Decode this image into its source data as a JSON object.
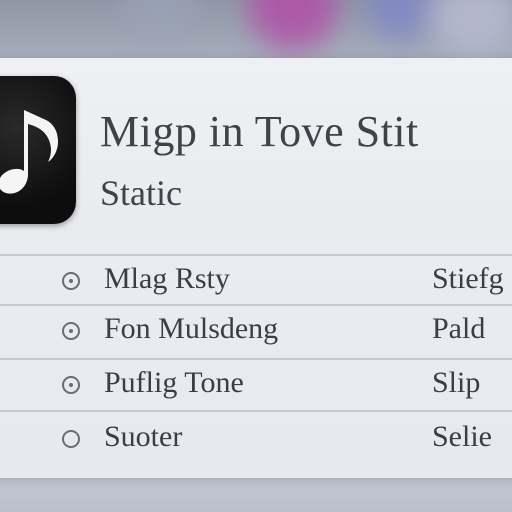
{
  "header": {
    "title": "Migp in Tove Stit",
    "subtitle": "Static",
    "icon": "music-note-icon"
  },
  "options": [
    {
      "label": "Mlag Rsty",
      "value": "Stiefg",
      "icon": "radio-icon"
    },
    {
      "label": "Fon Mulsdeng",
      "value": "Pald",
      "icon": "radio-icon"
    },
    {
      "label": "Puflig Tone",
      "value": "Slip",
      "icon": "radio-icon"
    },
    {
      "label": "Suoter",
      "value": "Selie",
      "icon": "radio-icon"
    }
  ],
  "colors": {
    "panel": "#eceff3",
    "text": "#3f4247",
    "divider": "#c5c9d0",
    "app_icon": "#111111"
  }
}
